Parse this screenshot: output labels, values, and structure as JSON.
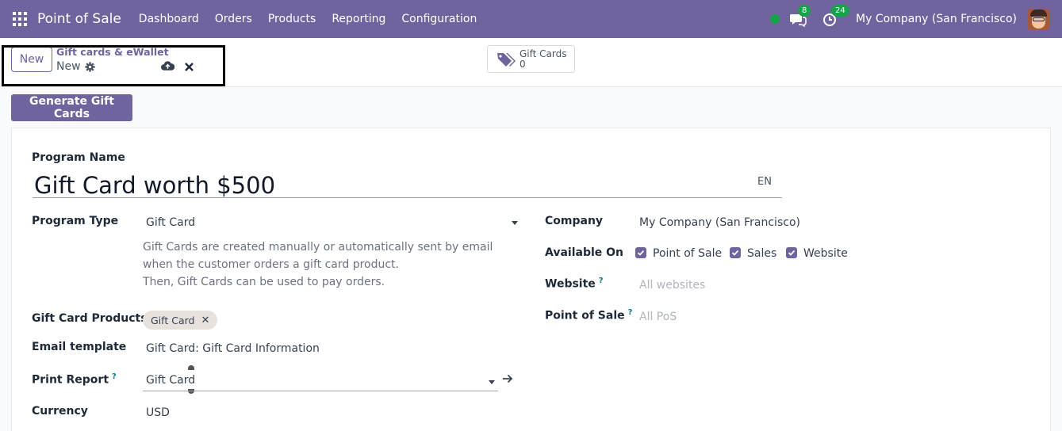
{
  "topbar": {
    "app_name": "Point of Sale",
    "menu": [
      "Dashboard",
      "Orders",
      "Products",
      "Reporting",
      "Configuration"
    ],
    "messages_count": "8",
    "activities_count": "24",
    "company": "My Company (San Francisco)"
  },
  "control": {
    "new_label": "New",
    "breadcrumb_parent": "Gift cards & eWallet",
    "breadcrumb_current": "New",
    "smart_button": {
      "label": "Gift Cards",
      "count": "0"
    }
  },
  "actions": {
    "generate_label": "Generate Gift Cards"
  },
  "form": {
    "program_name_label": "Program Name",
    "program_name_value": "Gift Card worth $500",
    "lang": "EN",
    "program_type_label": "Program Type",
    "program_type_value": "Gift Card",
    "program_type_desc_1": "Gift Cards are created manually or automatically sent by email when the customer orders a gift card product.",
    "program_type_desc_2": "Then, Gift Cards can be used to pay orders.",
    "gift_card_products_label": "Gift Card Products",
    "gift_card_products_tag": "Gift Card",
    "email_template_label": "Email template",
    "email_template_value": "Gift Card: Gift Card Information",
    "print_report_label": "Print Report",
    "print_report_help": "?",
    "print_report_value": "Gift Card",
    "currency_label": "Currency",
    "currency_value": "USD",
    "company_label": "Company",
    "company_value": "My Company (San Francisco)",
    "available_on_label": "Available On",
    "available_on": [
      {
        "label": "Point of Sale",
        "checked": true
      },
      {
        "label": "Sales",
        "checked": true
      },
      {
        "label": "Website",
        "checked": true
      }
    ],
    "website_label": "Website",
    "website_help": "?",
    "website_placeholder": "All websites",
    "pos_label": "Point of Sale",
    "pos_help": "?",
    "pos_placeholder": "All PoS"
  },
  "colors": {
    "brand": "#71639e",
    "presence": "#16a34a",
    "help": "#017e84"
  }
}
